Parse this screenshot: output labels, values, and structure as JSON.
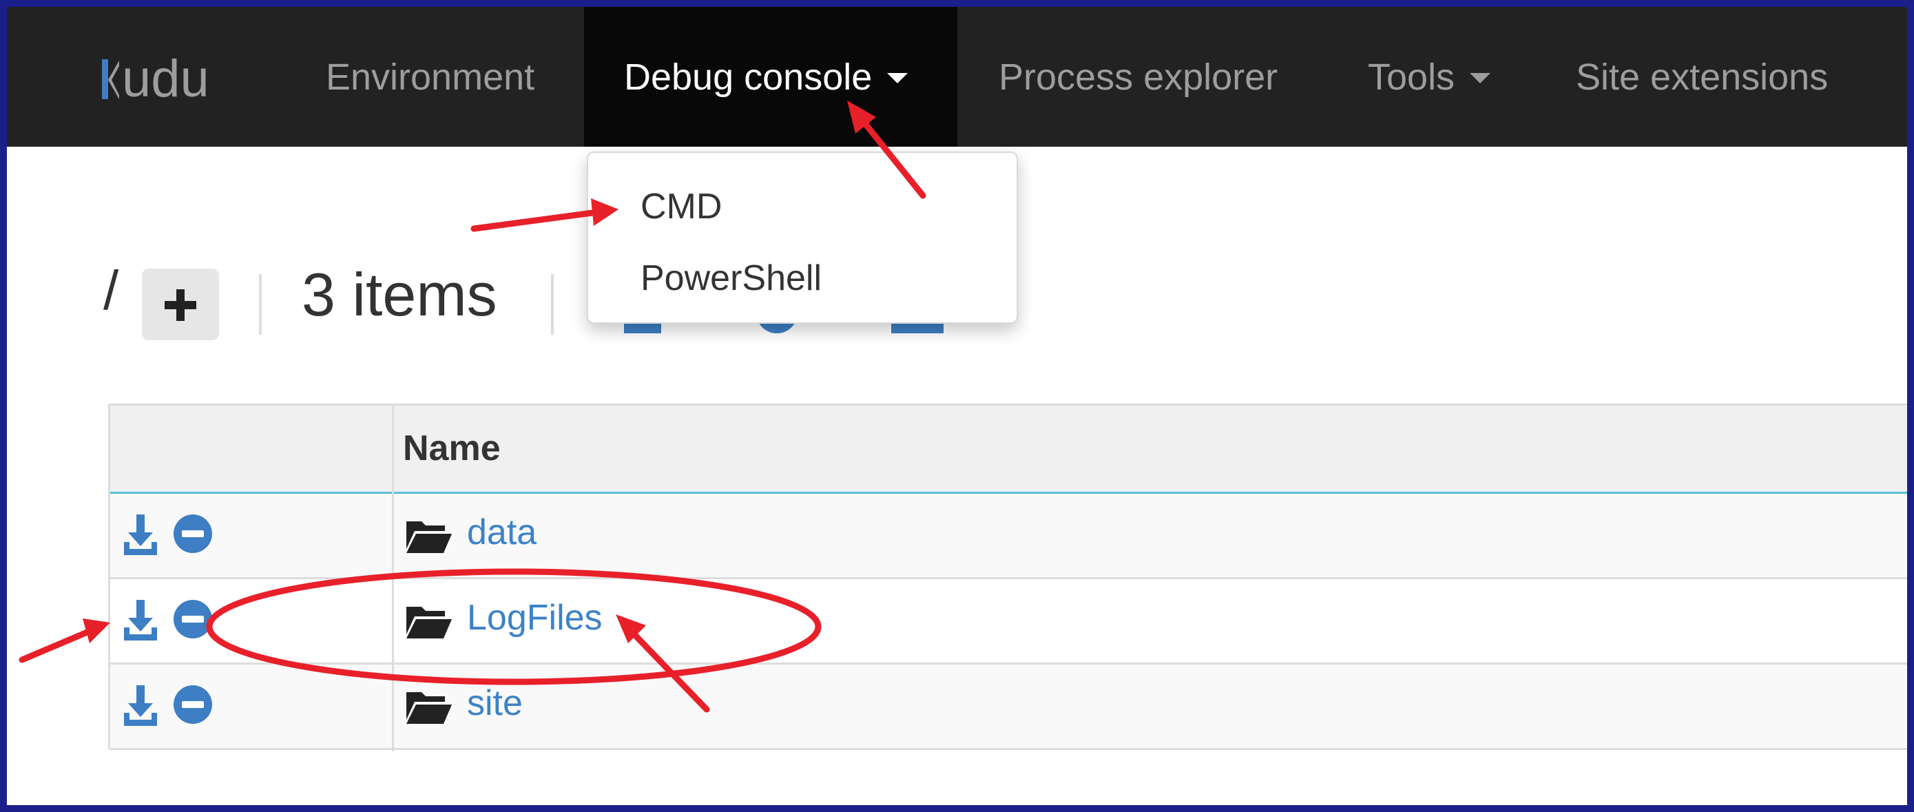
{
  "navbar": {
    "brand": "udu",
    "items": [
      {
        "label": "Environment"
      },
      {
        "label": "Debug console"
      },
      {
        "label": "Process explorer"
      },
      {
        "label": "Tools"
      },
      {
        "label": "Site extensions"
      }
    ]
  },
  "debug_menu": {
    "options": [
      {
        "label": "CMD"
      },
      {
        "label": "PowerShell"
      }
    ]
  },
  "toolbar": {
    "path": "/",
    "items_count": "3 items",
    "add_icon": "plus-icon"
  },
  "table": {
    "header_name": "Name",
    "rows": [
      {
        "name": "data",
        "icons": [
          "download-icon",
          "remove-icon",
          "folder-open-icon"
        ]
      },
      {
        "name": "LogFiles",
        "icons": [
          "download-icon",
          "remove-icon",
          "folder-open-icon"
        ]
      },
      {
        "name": "site",
        "icons": [
          "download-icon",
          "remove-icon",
          "folder-open-icon"
        ]
      }
    ]
  },
  "colors": {
    "navbar_bg": "#222222",
    "active_nav_bg": "#080808",
    "link": "#3c82c8",
    "icon_blue": "#3d7ec4",
    "annotation_red": "#e8202a",
    "frame_border": "#1b1f8a",
    "header_underline": "#5bc0de"
  }
}
